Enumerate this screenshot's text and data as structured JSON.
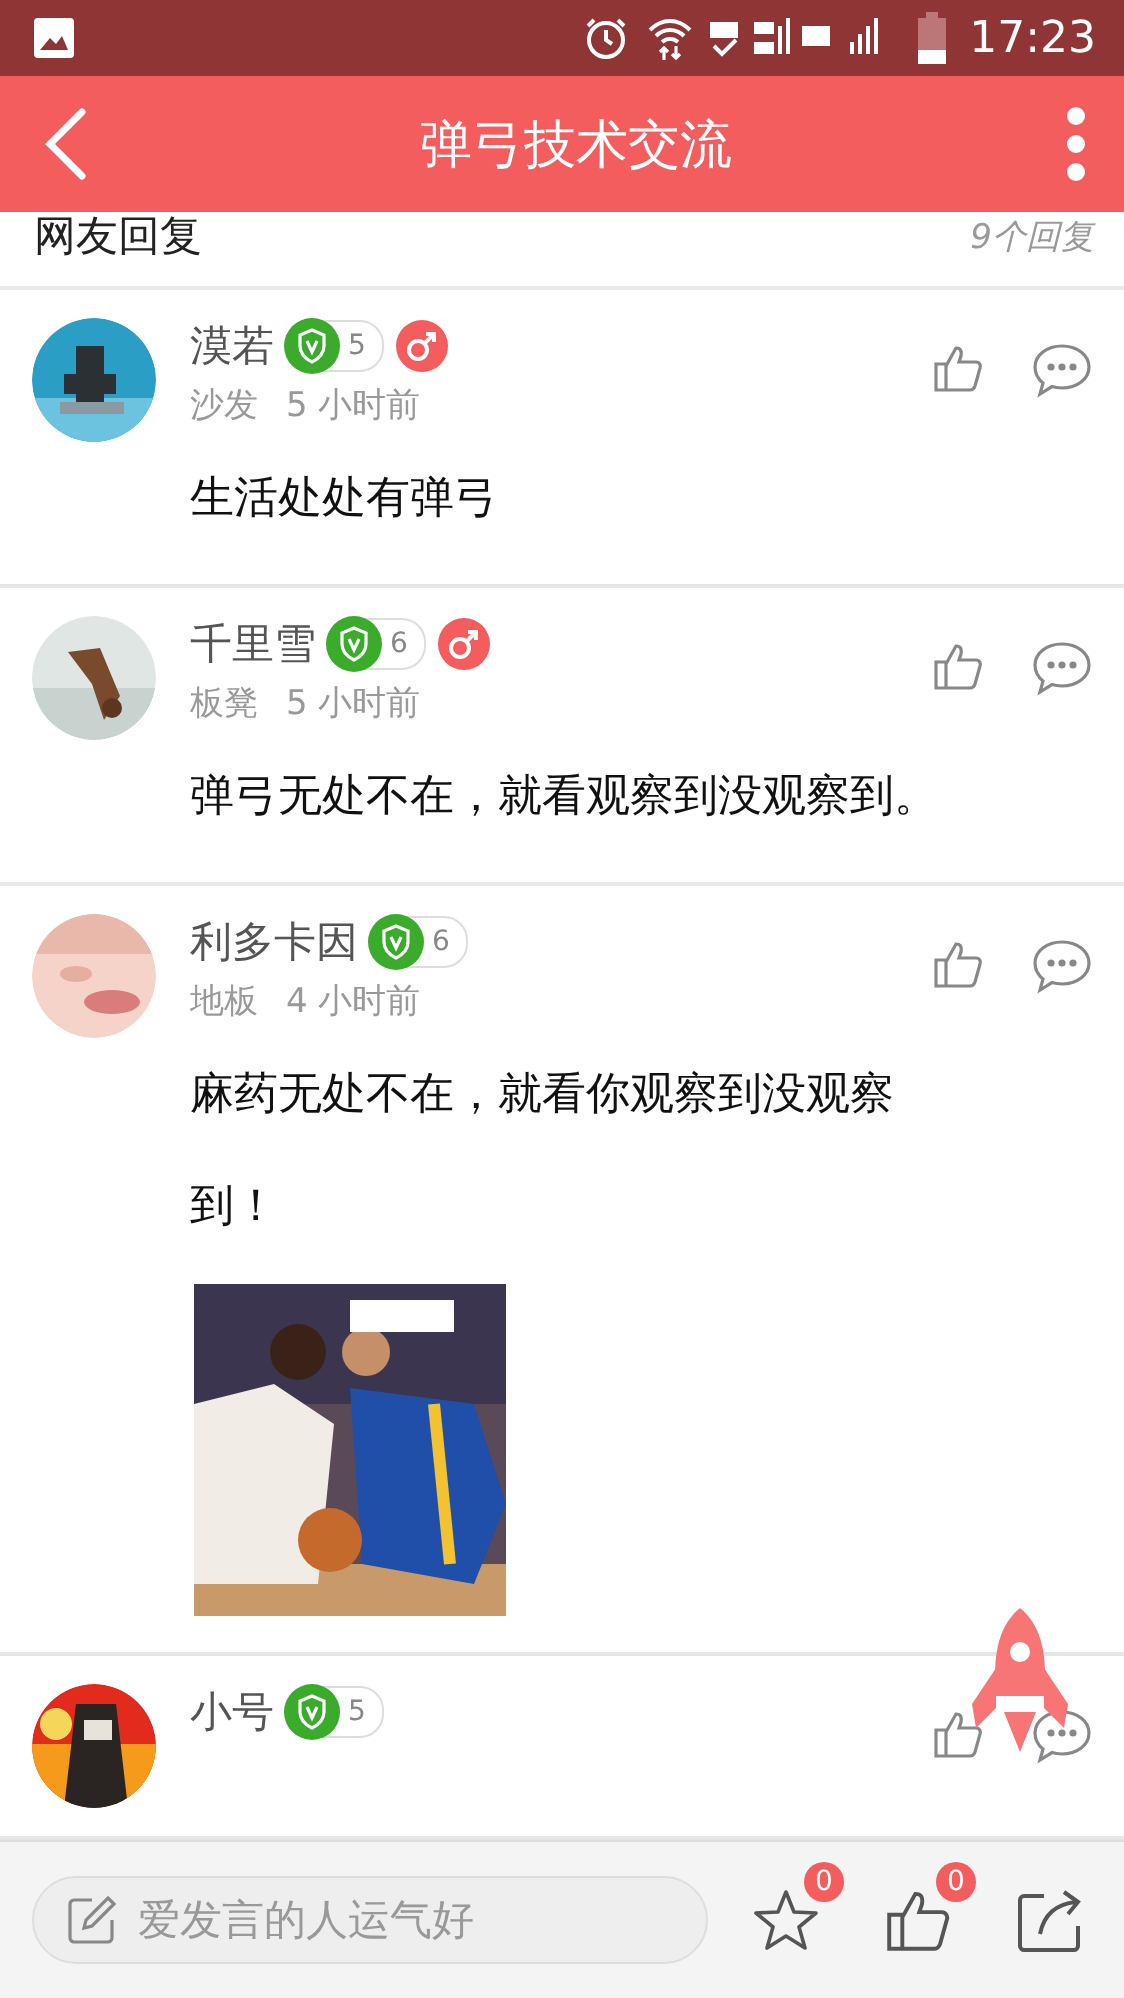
{
  "status_bar": {
    "time": "17:23"
  },
  "app_bar": {
    "title": "弹弓技术交流"
  },
  "replies_header": {
    "title": "网友回复",
    "count": "9个回复"
  },
  "posts": [
    {
      "name": "漠若",
      "rank": "5",
      "male_badge": true,
      "floor": "沙发",
      "time": "5 小时前",
      "text": "生活处处有弹弓"
    },
    {
      "name": "千里雪",
      "rank": "6",
      "male_badge": true,
      "floor": "板凳",
      "time": "5 小时前",
      "text": "弹弓无处不在，就看观察到没观察到。"
    },
    {
      "name": "利多卡因",
      "rank": "6",
      "male_badge": false,
      "floor": "地板",
      "time": "4 小时前",
      "text": "麻药无处不在，就看你观察到没观察到！"
    },
    {
      "name": "小号",
      "rank": "5",
      "male_badge": false
    }
  ],
  "bottom_bar": {
    "placeholder": "爱发言的人运气好",
    "favorites": "0",
    "likes": "0"
  }
}
